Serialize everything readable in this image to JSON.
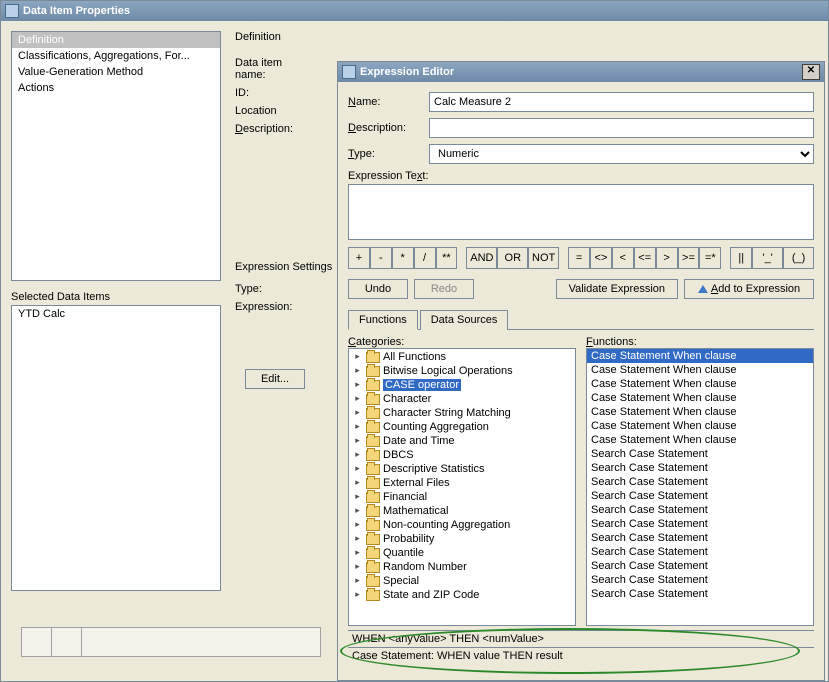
{
  "main": {
    "title": "Data Item Properties",
    "nav": [
      "Definition",
      "Classifications, Aggregations, For...",
      "Value-Generation Method",
      "Actions"
    ],
    "selectedNav": 0,
    "selectedLabel": "Selected Data Items",
    "selectedItems": [
      "YTD Calc"
    ],
    "form": {
      "heading": "Definition",
      "dataItemName_lbl": "Data item name:",
      "id_lbl": "ID:",
      "location_lbl": "Location",
      "description_lbl": "Description:",
      "expSettings_lbl": "Expression Settings",
      "type_lbl": "Type:",
      "expression_lbl": "Expression:",
      "edit_btn": "Edit..."
    }
  },
  "editor": {
    "title": "Expression Editor",
    "name_lbl": "Name:",
    "name_val": "Calc Measure 2",
    "desc_lbl": "Description:",
    "desc_val": "",
    "type_lbl": "Type:",
    "type_val": "Numeric",
    "exptext_lbl": "Expression Text:",
    "exptext_val": "",
    "operators": [
      "+",
      "-",
      "*",
      "/",
      "**",
      "AND",
      "OR",
      "NOT",
      "=",
      "<>",
      "<",
      "<=",
      ">",
      ">=",
      "=*",
      "||",
      "'_'",
      "(_)"
    ],
    "undo_lbl": "Undo",
    "redo_lbl": "Redo",
    "validate_lbl": "Validate Expression",
    "add_lbl": "Add to Expression",
    "tabs": [
      "Functions",
      "Data Sources"
    ],
    "activeTab": 0,
    "categories_lbl": "Categories:",
    "functions_lbl": "Functions:",
    "categories": [
      "All Functions",
      "Bitwise Logical Operations",
      "CASE operator",
      "Character",
      "Character String Matching",
      "Counting Aggregation",
      "Date and Time",
      "DBCS",
      "Descriptive Statistics",
      "External Files",
      "Financial",
      "Mathematical",
      "Non-counting Aggregation",
      "Probability",
      "Quantile",
      "Random Number",
      "Special",
      "State and ZIP Code"
    ],
    "selectedCategory": 2,
    "funcs": [
      "Case Statement When clause",
      "Case Statement When clause",
      "Case Statement When clause",
      "Case Statement When clause",
      "Case Statement When clause",
      "Case Statement When clause",
      "Case Statement When clause",
      "Search Case Statement",
      "Search Case Statement",
      "Search Case Statement",
      "Search Case Statement",
      "Search Case Statement",
      "Search Case Statement",
      "Search Case Statement",
      "Search Case Statement",
      "Search Case Statement",
      "Search Case Statement",
      "Search Case Statement"
    ],
    "selectedFunc": 0,
    "hint1": "WHEN <anyValue> THEN <numValue>",
    "hint2": "Case Statement: WHEN value THEN result"
  }
}
